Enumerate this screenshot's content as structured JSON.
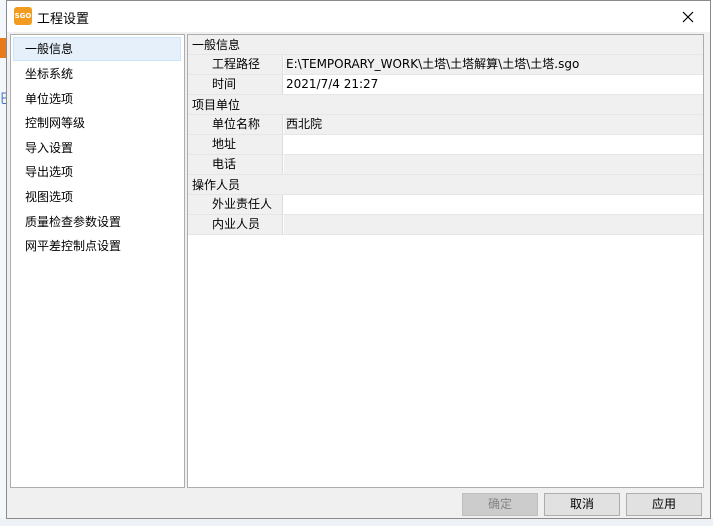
{
  "window": {
    "title": "工程设置",
    "icon_text": "SGO"
  },
  "nav": {
    "items": [
      {
        "label": "一般信息",
        "selected": true
      },
      {
        "label": "坐标系统"
      },
      {
        "label": "单位选项"
      },
      {
        "label": "控制网等级"
      },
      {
        "label": "导入设置"
      },
      {
        "label": "导出选项"
      },
      {
        "label": "视图选项"
      },
      {
        "label": "质量检查参数设置"
      },
      {
        "label": "网平差控制点设置"
      }
    ]
  },
  "properties": {
    "general": {
      "category": "一般信息",
      "path_label": "工程路径",
      "path_value": "E:\\TEMPORARY_WORK\\土塔\\土塔解算\\土塔\\土塔.sgo",
      "time_label": "时间",
      "time_value": "2021/7/4 21:27"
    },
    "unit": {
      "category": "项目单位",
      "name_label": "单位名称",
      "name_value": "西北院",
      "address_label": "地址",
      "address_value": "",
      "phone_label": "电话",
      "phone_value": ""
    },
    "staff": {
      "category": "操作人员",
      "field_label": "外业责任人",
      "field_value": "",
      "office_label": "内业人员",
      "office_value": ""
    }
  },
  "buttons": {
    "ok": "确定",
    "cancel": "取消",
    "apply": "应用"
  },
  "colors": {
    "selection": "#e5f0fb",
    "icon_orange": "#f29c1f"
  }
}
